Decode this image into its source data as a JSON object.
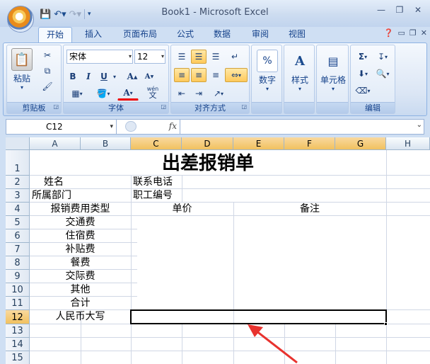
{
  "window": {
    "title": "Book1 - Microsoft Excel"
  },
  "tabs": [
    "开始",
    "插入",
    "页面布局",
    "公式",
    "数据",
    "审阅",
    "视图"
  ],
  "ribbon": {
    "clipboard": {
      "paste": "粘贴",
      "label": "剪贴板"
    },
    "font": {
      "name": "宋体",
      "size": "12",
      "bold": "B",
      "italic": "I",
      "underline": "U",
      "grow": "A",
      "shrink": "A",
      "color_letter": "A",
      "wen": "wén",
      "wen2": "文",
      "label": "字体"
    },
    "align": {
      "label": "对齐方式"
    },
    "number": {
      "label": "数字",
      "symbol": "%"
    },
    "style": {
      "label": "样式",
      "symbol": "A"
    },
    "cells": {
      "label": "单元格"
    },
    "editing": {
      "label": "编辑",
      "sum": "Σ"
    }
  },
  "formula_bar": {
    "name_box": "C12",
    "fx": "fx",
    "content": ""
  },
  "columns": [
    "A",
    "B",
    "C",
    "D",
    "E",
    "F",
    "G",
    "H"
  ],
  "rows": [
    "1",
    "2",
    "3",
    "4",
    "5",
    "6",
    "7",
    "8",
    "9",
    "10",
    "11",
    "12",
    "13",
    "14",
    "15"
  ],
  "sheet": {
    "title": "出差报销单",
    "r2_a": "姓名",
    "r2_c": "联系电话",
    "r3_a": "所属部门",
    "r3_c": "职工编号",
    "r4_a": "报销费用类型",
    "r4_c": "单价",
    "r4_e": "备注",
    "r5": "交通费",
    "r6": "住宿费",
    "r7": "补贴费",
    "r8": "餐费",
    "r9": "交际费",
    "r10": "其他",
    "r11": "合计",
    "r12": "人民币大写"
  },
  "colors": {
    "accent": "#f1c15f",
    "arrow": "#e8322e",
    "ribbon": "#dbe6f5"
  }
}
